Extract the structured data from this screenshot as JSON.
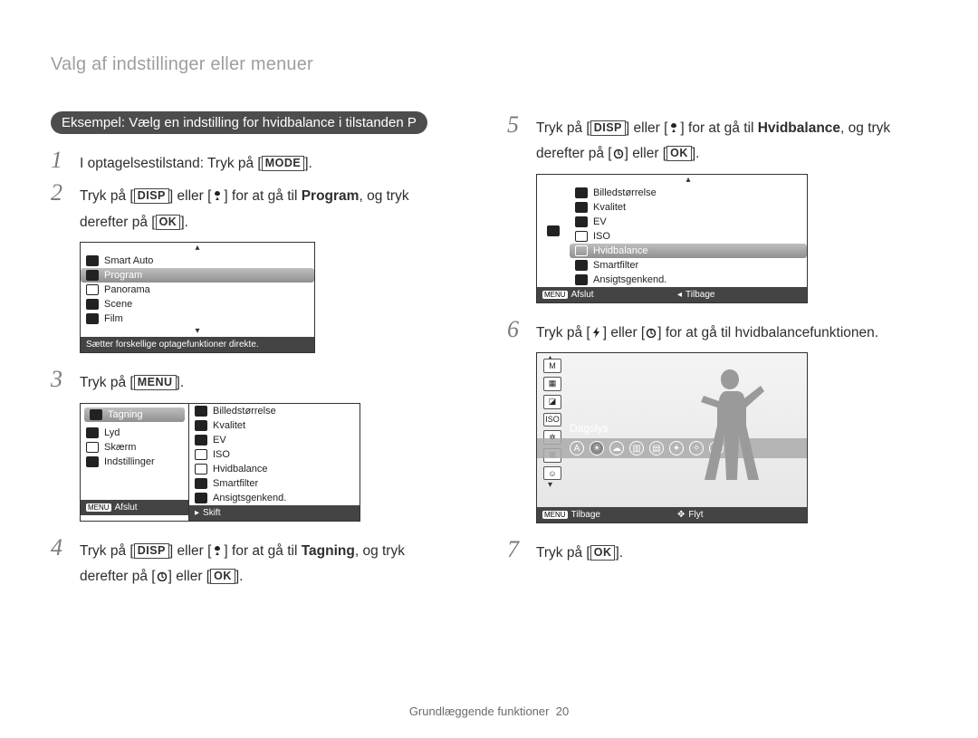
{
  "header": "Valg af indstillinger eller menuer",
  "example_label": "Eksempel: Vælg en indstilling for hvidbalance i tilstanden P",
  "steps": {
    "s1": {
      "num": "1",
      "pre": "I optagelsestilstand: Tryk på [",
      "btn": "MODE",
      "post": "]."
    },
    "s2": {
      "num": "2",
      "a": "Tryk på [",
      "btn1": "DISP",
      "b": "] eller [",
      "c": "] for at gå til ",
      "bold": "Program",
      "d": ", og tryk",
      "line2a": "derefter på [",
      "btn2": "OK",
      "line2b": "]."
    },
    "s3": {
      "num": "3",
      "a": "Tryk på [",
      "btn": "MENU",
      "b": "]."
    },
    "s4": {
      "num": "4",
      "a": "Tryk på [",
      "btn1": "DISP",
      "b": "] eller [",
      "c": "] for at gå til ",
      "bold": "Tagning",
      "d": ", og tryk",
      "line2a": "derefter på [",
      "line2b": "] eller [",
      "btn2": "OK",
      "line2c": "]."
    },
    "s5": {
      "num": "5",
      "a": "Tryk på [",
      "btn1": "DISP",
      "b": "] eller [",
      "c": "] for at gå til ",
      "bold": "Hvidbalance",
      "d": ", og tryk",
      "line2a": "derefter på [",
      "line2b": "] eller [",
      "btn2": "OK",
      "line2c": "]."
    },
    "s6": {
      "num": "6",
      "a": "Tryk på [",
      "b": "] eller [",
      "c": "] for at gå til hvidbalancefunktionen."
    },
    "s7": {
      "num": "7",
      "a": "Tryk på [",
      "btn": "OK",
      "b": "]."
    }
  },
  "shot_modes": {
    "items": [
      "Smart Auto",
      "Program",
      "Panorama",
      "Scene",
      "Film"
    ],
    "highlight_index": 1,
    "caption": "Sætter forskellige optagefunktioner direkte."
  },
  "shot_menu": {
    "left": [
      "Tagning",
      "Lyd",
      "Skærm",
      "Indstillinger"
    ],
    "left_highlight_index": 0,
    "right": [
      "Billedstørrelse",
      "Kvalitet",
      "EV",
      "ISO",
      "Hvidbalance",
      "Smartfilter",
      "Ansigtsgenkend."
    ],
    "footer_left_label": "MENU",
    "footer_left_text": "Afslut",
    "footer_right_text": "Skift"
  },
  "shot_wb_menu": {
    "items": [
      "Billedstørrelse",
      "Kvalitet",
      "EV",
      "ISO",
      "Hvidbalance",
      "Smartfilter",
      "Ansigtsgenkend."
    ],
    "highlight_index": 4,
    "footer_left_label": "MENU",
    "footer_left_text": "Afslut",
    "footer_right_text": "Tilbage"
  },
  "shot_wb_live": {
    "label": "Dagslys",
    "footer_left_label": "MENU",
    "footer_left_text": "Tilbage",
    "footer_right_text": "Flyt"
  },
  "footer": {
    "text": "Grundlæggende funktioner",
    "page": "20"
  }
}
